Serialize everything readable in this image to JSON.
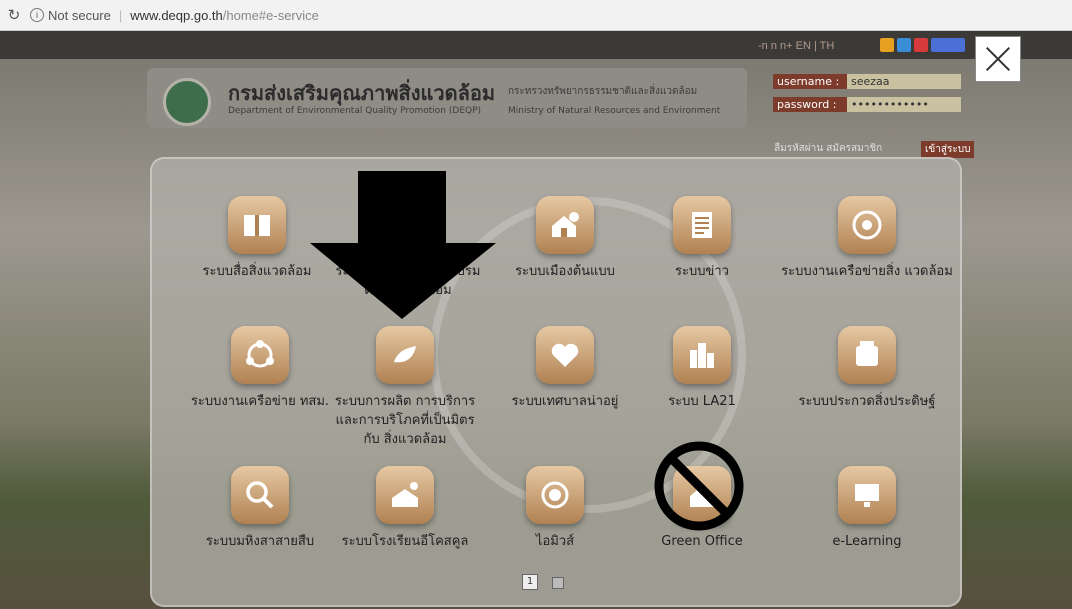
{
  "browser": {
    "security": "Not secure",
    "url_host": "www.deqp.go.th",
    "url_path": "/home#e-service"
  },
  "site": {
    "lang_links": "-n n n+   EN | TH",
    "title_thai": "กรมส่งเสริมคุณภาพสิ่งแวดล้อม",
    "title_en": "Department of Environmental Quality Promotion (DEQP)",
    "ministry_thai": "กระทรวงทรัพยากรธรรมชาติและสิ่งแวดล้อม",
    "ministry_en": "Ministry of Natural Resources and Environment",
    "login": {
      "username_label": "username :",
      "username_value": "seezaa",
      "password_label": "password :",
      "password_value": "••••••••••••",
      "forgot": "ลืมรหัสผ่าน  สมัครสมาชิก",
      "login_button": "เข้าสู่ระบบ"
    }
  },
  "modal": {
    "items": [
      {
        "label": "ระบบสื่อสิ่งแวดล้อม",
        "icon": "book-icon"
      },
      {
        "label": "ระบบลงทะเบียน ฝึก อบรมด้านสิ่งแวดล้อม",
        "icon": "training-icon"
      },
      {
        "label": "ระบบเมืองต้นแบบ",
        "icon": "house-tree-icon"
      },
      {
        "label": "ระบบข่าว",
        "icon": "news-document-icon"
      },
      {
        "label": "ระบบงานเครือข่ายสิ่ง แวดล้อม",
        "icon": "network-leaf-icon"
      },
      {
        "label": "ระบบงานเครือข่าย ทสม.",
        "icon": "people-network-icon"
      },
      {
        "label": "ระบบการผลิต การบริการ และการบริโภคที่เป็นมิตรกับ สิ่งแวดล้อม",
        "icon": "eco-plug-icon"
      },
      {
        "label": "ระบบเทศบาลน่าอยู่",
        "icon": "heart-home-icon"
      },
      {
        "label": "ระบบ LA21",
        "icon": "city-buildings-icon"
      },
      {
        "label": "ระบบประกวดสิ่งประดิษฐ์",
        "icon": "invention-machine-icon"
      },
      {
        "label": "ระบบมหิงสาสายสืบ",
        "icon": "magnifier-icon"
      },
      {
        "label": "ระบบโรงเรียนอีโคสคูล",
        "icon": "school-tree-icon"
      },
      {
        "label": "ไอมิวส์",
        "icon": "eco-badge-icon"
      },
      {
        "label": "Green Office",
        "icon": "green-office-icon"
      },
      {
        "label": "e-Learning",
        "icon": "elearning-screen-icon"
      }
    ],
    "page_current": "1"
  },
  "colors": {
    "tile_top": "#e6c8a3",
    "tile_bottom": "#b08152",
    "header_dark": "#3c3a36",
    "login_label": "#7d3b2c"
  }
}
